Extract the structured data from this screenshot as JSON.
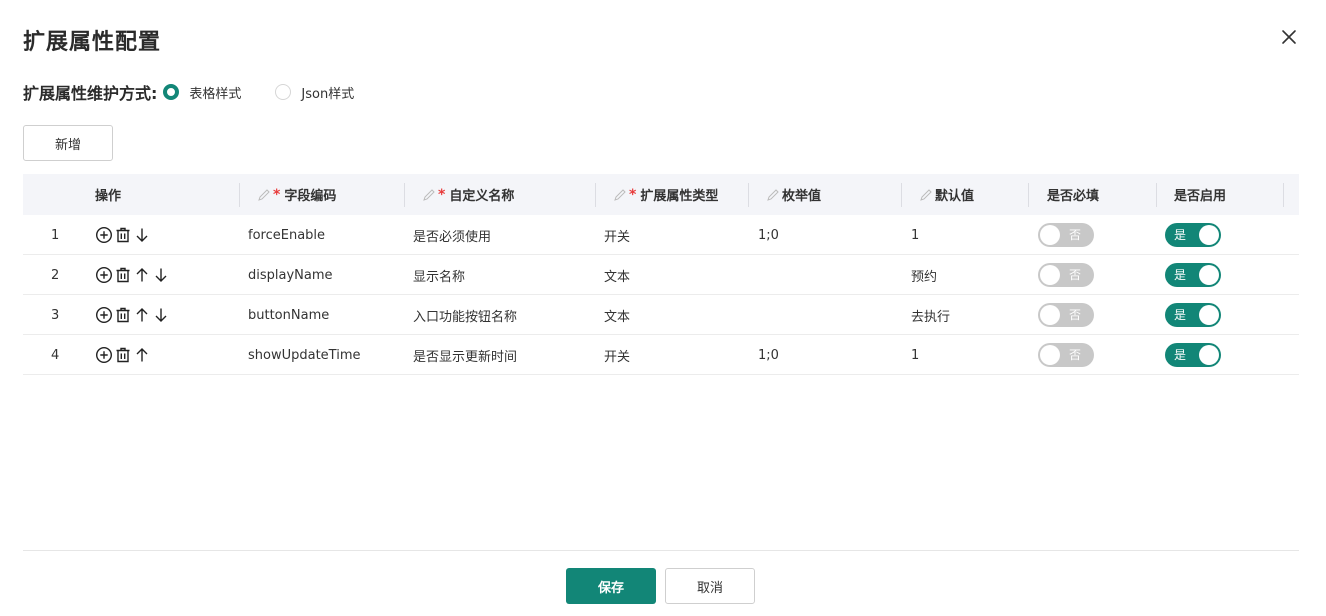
{
  "dialog": {
    "title": "扩展属性配置"
  },
  "mode": {
    "label": "扩展属性维护方式:",
    "options": [
      {
        "label": "表格样式",
        "checked": true
      },
      {
        "label": "Json样式",
        "checked": false
      }
    ]
  },
  "toolbar": {
    "add_label": "新增"
  },
  "table": {
    "columns": {
      "ops": "操作",
      "field_code": "字段编码",
      "custom_name": "自定义名称",
      "attr_type": "扩展属性类型",
      "enum_value": "枚举值",
      "default_value": "默认值",
      "required": "是否必填",
      "enabled": "是否启用"
    },
    "toggle_on_label": "是",
    "toggle_off_label": "否",
    "rows": [
      {
        "index": "1",
        "ops": [
          "add",
          "delete",
          "down"
        ],
        "field_code": "forceEnable",
        "custom_name": "是否必须使用",
        "attr_type": "开关",
        "enum_value": "1;0",
        "default_value": "1",
        "required": false,
        "enabled": true
      },
      {
        "index": "2",
        "ops": [
          "add",
          "delete",
          "up",
          "down"
        ],
        "field_code": "displayName",
        "custom_name": "显示名称",
        "attr_type": "文本",
        "enum_value": "",
        "default_value": "预约",
        "required": false,
        "enabled": true
      },
      {
        "index": "3",
        "ops": [
          "add",
          "delete",
          "up",
          "down"
        ],
        "field_code": "buttonName",
        "custom_name": "入口功能按钮名称",
        "attr_type": "文本",
        "enum_value": "",
        "default_value": "去执行",
        "required": false,
        "enabled": true
      },
      {
        "index": "4",
        "ops": [
          "add",
          "delete",
          "up"
        ],
        "field_code": "showUpdateTime",
        "custom_name": "是否显示更新时间",
        "attr_type": "开关",
        "enum_value": "1;0",
        "default_value": "1",
        "required": false,
        "enabled": true
      }
    ]
  },
  "footer": {
    "save_label": "保存",
    "cancel_label": "取消"
  },
  "colors": {
    "accent": "#128677",
    "toggle_off": "#c8c8c8",
    "required_star": "#e83b3b",
    "header_bg": "#f4f5f9"
  }
}
